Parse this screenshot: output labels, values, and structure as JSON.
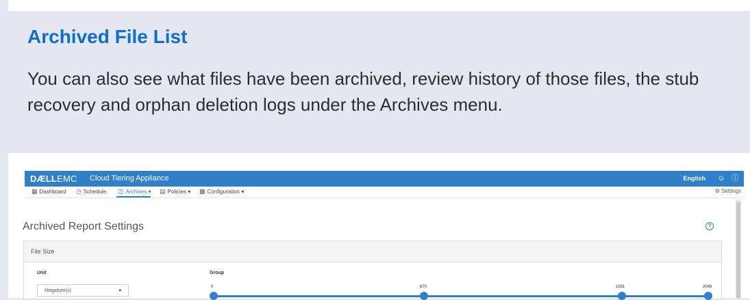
{
  "slide": {
    "title": "Archived File List",
    "body": "You can also see what files have been archived, review history of those files, the stub recovery and orphan deletion logs under the Archives menu."
  },
  "app": {
    "brand": "DELLEMC",
    "brand_strong": "DÆLL",
    "brand_light": "EMC",
    "name": "Cloud Tiering Appliance",
    "language": "English",
    "icons": {
      "user": "user-icon",
      "help": "help-icon"
    },
    "colors": {
      "header": "#2f7fc9",
      "accent": "#2f7fc9",
      "title": "#0c6fd0"
    }
  },
  "nav": {
    "items": [
      {
        "label": "Dashboard",
        "icon": "dashboard-icon"
      },
      {
        "label": "Schedule",
        "icon": "clock-icon"
      },
      {
        "label": "Archives ▾",
        "icon": "archive-icon",
        "active": true
      },
      {
        "label": "Policies ▾",
        "icon": "policy-icon"
      },
      {
        "label": "Configuration ▾",
        "icon": "config-icon"
      }
    ],
    "settings": "Settings"
  },
  "page": {
    "heading": "Archived Report Settings",
    "card_title": "File Size",
    "unit_label": "Unit",
    "unit_value": "Megabyte(s)",
    "group_label": "Group",
    "slider": {
      "min": 0,
      "max": 2048,
      "values": [
        0,
        870,
        1691,
        2048
      ],
      "tick_labels": [
        "0",
        "870",
        "1691",
        "2048"
      ]
    }
  }
}
